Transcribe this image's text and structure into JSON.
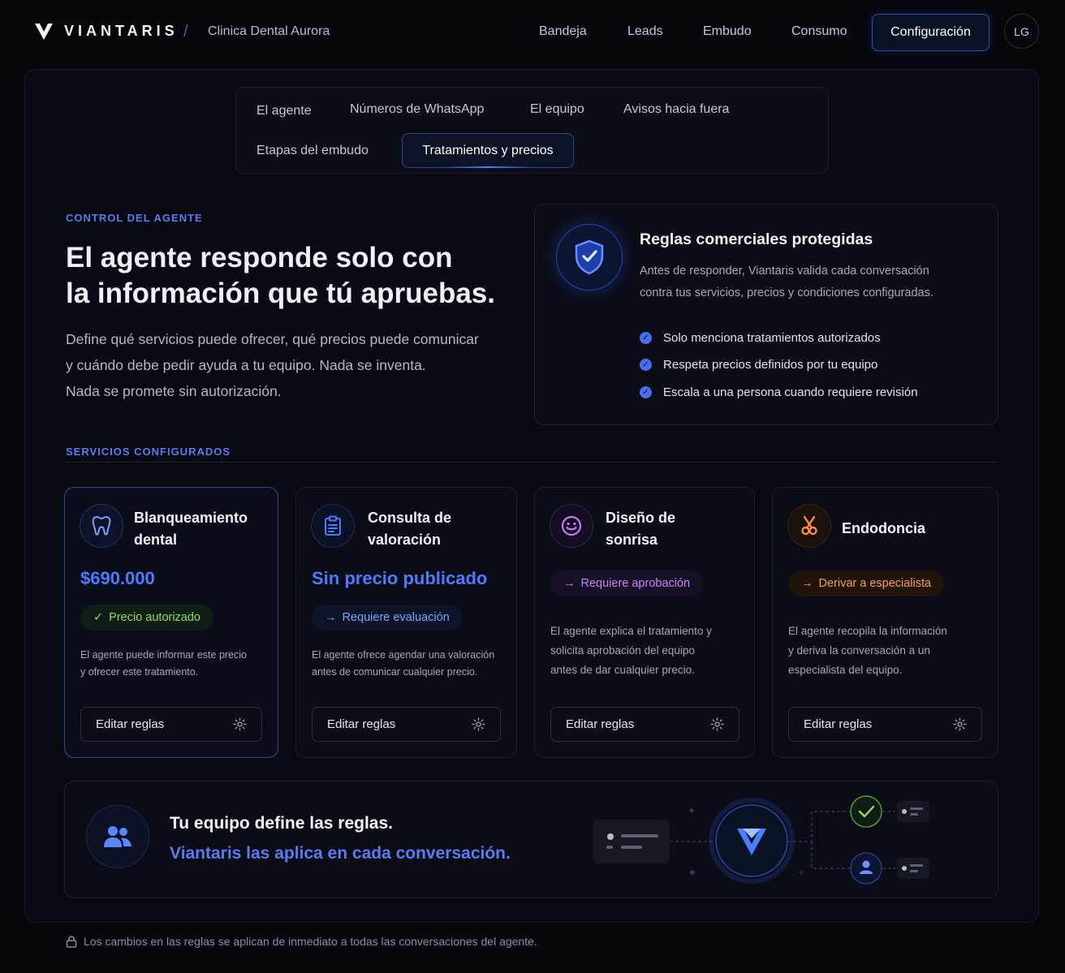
{
  "header": {
    "brand": "VIANTARIS",
    "separator": "/",
    "clinic": "Clinica Dental Aurora",
    "nav": [
      "Bandeja",
      "Leads",
      "Embudo",
      "Consumo"
    ],
    "active_nav": "Configuración",
    "avatar_initials": "LG"
  },
  "tabs": {
    "row1": [
      "El agente",
      "Números de WhatsApp",
      "El equipo",
      "Avisos hacia fuera"
    ],
    "row2_inactive": "Etapas del embudo",
    "active": "Tratamientos y precios"
  },
  "hero": {
    "eyebrow": "CONTROL DEL AGENTE",
    "title_line1": "El agente responde solo con",
    "title_line2": "la información que tú apruebas.",
    "desc_line1": "Define qué servicios puede ofrecer, qué precios puede comunicar",
    "desc_line2": "y cuándo debe pedir ayuda a tu equipo. Nada se inventa.",
    "desc_line3": "Nada se promete sin autorización."
  },
  "rules_card": {
    "icon": "shield-check-icon",
    "title": "Reglas comerciales protegidas",
    "desc_line1": "Antes de responder, Viantaris valida cada conversación",
    "desc_line2": "contra tus servicios, precios y condiciones configuradas.",
    "checks": [
      "Solo menciona tratamientos autorizados",
      "Respeta precios definidos por tu equipo",
      "Escala a una persona cuando requiere revisión"
    ]
  },
  "services_heading": "SERVICIOS CONFIGURADOS",
  "services": [
    {
      "icon": "tooth-icon",
      "title_line1": "Blanqueamiento",
      "title_line2": "dental",
      "price": "$690.000",
      "pill": "Precio autorizado",
      "pill_icon": "✓",
      "desc_line1": "El agente puede informar este precio",
      "desc_line2": "y ofrecer este tratamiento.",
      "button": "Editar reglas"
    },
    {
      "icon": "clipboard-icon",
      "title_line1": "Consulta de",
      "title_line2": "valoración",
      "price": "Sin precio publicado",
      "pill": "Requiere evaluación",
      "pill_icon": "→",
      "desc_line1": "El agente ofrece agendar una valoración",
      "desc_line2": "antes de comunicar cualquier precio.",
      "button": "Editar reglas"
    },
    {
      "icon": "smile-icon",
      "title_line1": "Diseño de",
      "title_line2": "sonrisa",
      "pill": "Requiere aprobación",
      "pill_icon": "→",
      "desc_line1": "El agente explica el tratamiento y",
      "desc_line2": "solicita aprobación del equipo",
      "desc_line3": "antes de dar cualquier precio.",
      "button": "Editar reglas"
    },
    {
      "icon": "dental-tool-icon",
      "title_line1": "Endodoncia",
      "pill": "Derivar a especialista",
      "pill_icon": "→",
      "desc_line1": "El agente recopila la información",
      "desc_line2": "y deriva la conversación a un",
      "desc_line3": "especialista del equipo.",
      "button": "Editar reglas"
    }
  ],
  "banner": {
    "icon": "team-icon",
    "title": "Tu equipo define las reglas.",
    "subtitle": "Viantaris las aplica en cada conversación."
  },
  "footer_note": "Los cambios en las reglas se aplican de inmediato a todas las conversaciones del agente.",
  "colors": {
    "accent": "#4d7bff",
    "green": "#7ed957",
    "purple": "#b06cf0",
    "orange": "#ff8a3d",
    "background": "#05070d"
  }
}
